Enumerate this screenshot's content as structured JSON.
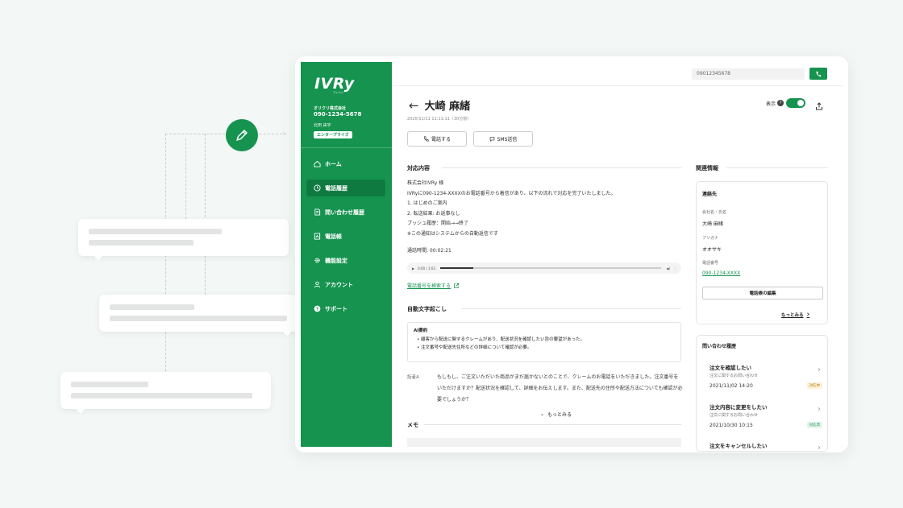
{
  "app": {
    "logo_text": "IVRy",
    "logo_sub": "アイブリー",
    "company": "オリクリ株式会社",
    "company_phone": "090-1234-5678",
    "user_name": "北田 由宇",
    "plan": "エンタープライズ"
  },
  "nav": {
    "items": [
      {
        "label": "ホーム",
        "icon": "home-icon"
      },
      {
        "label": "電話履歴",
        "icon": "clock-icon"
      },
      {
        "label": "問い合わせ履歴",
        "icon": "document-icon"
      },
      {
        "label": "電話帳",
        "icon": "phonebook-icon"
      },
      {
        "label": "機能設定",
        "icon": "gear-icon"
      },
      {
        "label": "アカウント",
        "icon": "user-icon"
      },
      {
        "label": "サポート",
        "icon": "help-icon"
      }
    ],
    "active_index": 1
  },
  "topbar": {
    "phone_value": "09012345678"
  },
  "header": {
    "title": "大崎 麻緒",
    "timestamp": "2020/11/11 11:11:11（30分前）",
    "display_label": "表示",
    "call_button": "電話する",
    "sms_button": "SMS送信"
  },
  "response": {
    "heading": "対応内容",
    "lines": [
      "株式会社IVRy 様",
      "IVRyに090-1234-XXXXのお電話番号から着信があり、以下の流れで対応を完了いたしました。",
      " 1. はじめのご案内",
      " 2. 転送結果: お返事なし",
      "プッシュ履歴：開始→→終了",
      "※この通知はシステムからの自動返信です"
    ],
    "call_duration": "通話時間: 00:02:21",
    "audio_time": "0:00 / 1:03",
    "audio_progress": 0.15,
    "search_link": "電話番号を検索する"
  },
  "transcription": {
    "heading": "自動文字起こし",
    "ai_label": "AI要約",
    "ai_items": [
      "顧客から配送に関するクレームがあり、配送状況を確認したい旨の要望があった。",
      "注文番号や配送先住所などの詳細について確認が必要。"
    ],
    "speaker": "話者A",
    "text": "もしもし、ご注文いただいた商品がまだ届かないとのことで、クレームのお電話をいただきました。注文番号をいただけますか？配送状況を確認して、詳細をお伝えします。また、配送先の住所や配送方法についても確認が必要でしょうか？",
    "more": "もっとみる"
  },
  "memo": {
    "heading": "メモ"
  },
  "related": {
    "heading": "関連情報",
    "contact": {
      "title": "連絡先",
      "name_label": "会社名・氏名",
      "name_value": "大崎 麻緒",
      "kana_label": "フリガナ",
      "kana_value": "オオサキ",
      "phone_label": "電話番号",
      "phone_value": "090-1234-XXXX",
      "edit_button": "電話帳の編集",
      "more": "もっとみる"
    },
    "history": {
      "title": "問い合わせ履歴",
      "items": [
        {
          "title": "注文を確認したい",
          "sub": "注文に関するお問い合わせ",
          "date": "2021/11/02 14:20",
          "status": "対応中",
          "status_color": "#b07810"
        },
        {
          "title": "注文内容に変更をしたい",
          "sub": "注文に関するお問い合わせ",
          "date": "2021/10/30 10:15",
          "status": "対応済",
          "status_color": "#15934f"
        },
        {
          "title": "注文をキャンセルしたい",
          "sub": "",
          "date": "",
          "status": "",
          "status_color": ""
        }
      ]
    }
  },
  "colors": {
    "brand": "#15934f",
    "brand_dark": "#0f7a40",
    "background": "#f3f7f5"
  }
}
